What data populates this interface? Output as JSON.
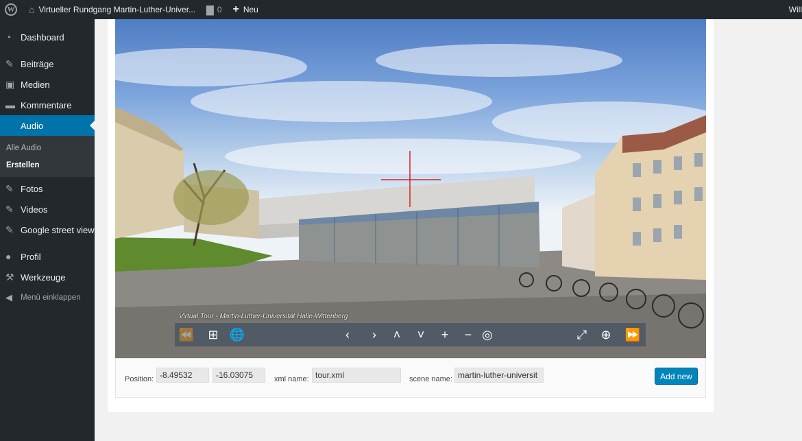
{
  "adminbar": {
    "site_title": "Virtueller Rundgang Martin-Luther-Univer...",
    "comments_count": "0",
    "new_label": "Neu",
    "user_label": "Will"
  },
  "sidebar": {
    "items": [
      {
        "label": "Dashboard",
        "icon": "dashboard-icon"
      },
      {
        "label": "Beiträge",
        "icon": "pin-icon"
      },
      {
        "label": "Medien",
        "icon": "media-icon"
      },
      {
        "label": "Kommentare",
        "icon": "comment-icon"
      },
      {
        "label": "Audio",
        "icon": "pin-icon"
      },
      {
        "label": "Fotos",
        "icon": "pin-icon"
      },
      {
        "label": "Videos",
        "icon": "pin-icon"
      },
      {
        "label": "Google street view",
        "icon": "pin-icon"
      },
      {
        "label": "Profil",
        "icon": "user-icon"
      },
      {
        "label": "Werkzeuge",
        "icon": "wrench-icon"
      }
    ],
    "submenu": [
      "Alle Audio",
      "Erstellen"
    ],
    "collapse_label": "Menü einklappen"
  },
  "pano": {
    "caption": "Virtual Tour - Martin-Luther-Universität Halle-Wittenberg"
  },
  "form": {
    "position_label": "Position:",
    "position_x": "-8.49532",
    "position_y": "-16.03075",
    "xml_label": "xml name:",
    "xml_value": "tour.xml",
    "scene_label": "scene name:",
    "scene_value": "martin-luther-universit",
    "add_new_label": "Add new"
  },
  "colors": {
    "admin_dark": "#23282d",
    "accent": "#0073aa",
    "button": "#0085ba"
  }
}
